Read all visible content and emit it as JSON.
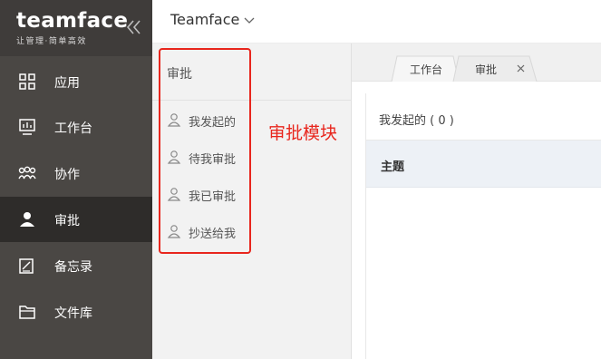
{
  "brand": {
    "name": "teamface",
    "tagline": "让管理·简单高效"
  },
  "sidebar": {
    "items": [
      {
        "label": "应用",
        "icon": "apps-grid-icon",
        "active": false
      },
      {
        "label": "工作台",
        "icon": "dashboard-monitor-icon",
        "active": false
      },
      {
        "label": "协作",
        "icon": "team-collaboration-icon",
        "active": false
      },
      {
        "label": "审批",
        "icon": "user-approval-icon",
        "active": true
      },
      {
        "label": "备忘录",
        "icon": "memo-note-icon",
        "active": false
      },
      {
        "label": "文件库",
        "icon": "folder-icon",
        "active": false
      }
    ]
  },
  "header": {
    "workspace": "Teamface"
  },
  "submenu": {
    "title": "审批",
    "items": [
      {
        "label": "我发起的",
        "icon": "user-outline-icon"
      },
      {
        "label": "待我审批",
        "icon": "user-outline-icon"
      },
      {
        "label": "我已审批",
        "icon": "user-outline-icon"
      },
      {
        "label": "抄送给我",
        "icon": "user-outline-icon"
      }
    ]
  },
  "annotation": {
    "text": "审批模块",
    "color": "#e8261d"
  },
  "tabs": [
    {
      "label": "工作台",
      "active": false,
      "closable": false
    },
    {
      "label": "审批",
      "active": true,
      "closable": true
    }
  ],
  "main": {
    "count_label": "我发起的 ( 0 )",
    "columns": [
      "主题"
    ]
  },
  "colors": {
    "sidebar_bg": "#4a4744",
    "sidebar_active": "#2e2c2a",
    "highlight": "#e8261d",
    "table_header_bg": "#edf1f6"
  }
}
